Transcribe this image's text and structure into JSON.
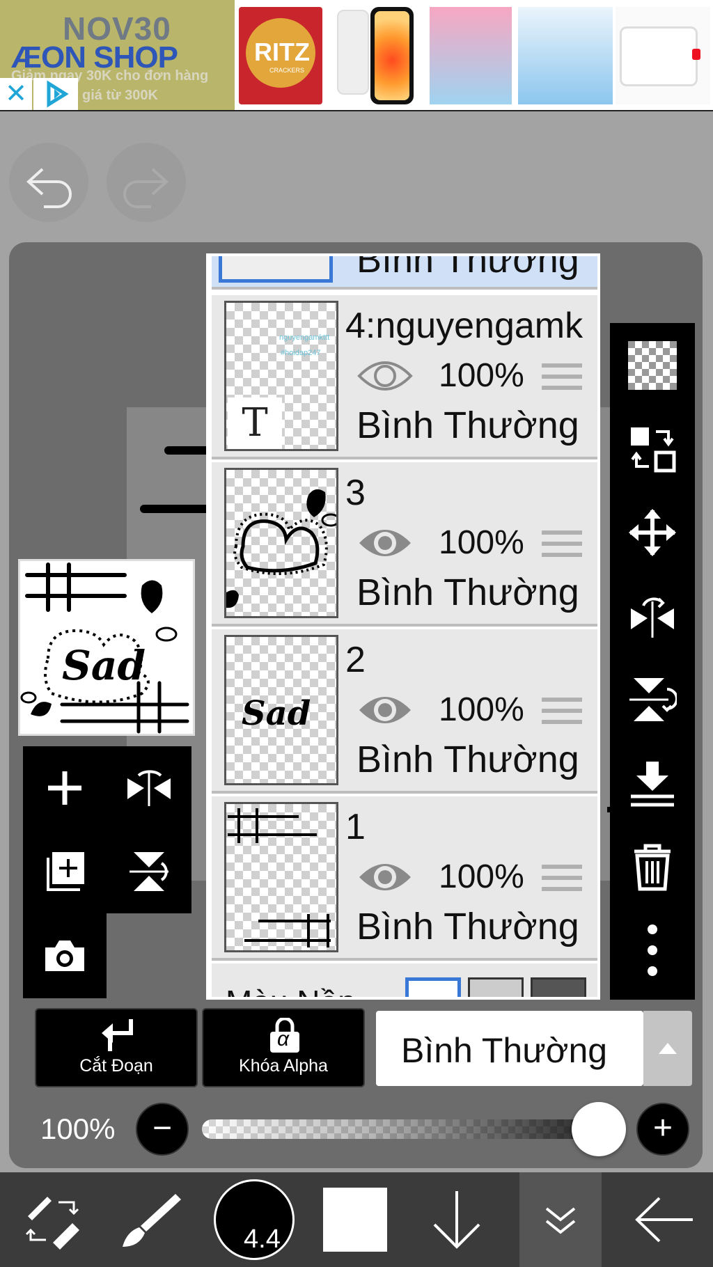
{
  "ad": {
    "promo_code": "NOV30",
    "brand_left": "ÆON",
    "brand_right": "SHOP",
    "line1": "Giảm ngay 30K cho đơn hàng",
    "line2": "giá từ 300K",
    "close_glyph": "✕",
    "product_ritz_text": "RITZ",
    "product_ritz_sub": "CRACKERS"
  },
  "toolbar_top": {
    "undo_icon": "undo-icon",
    "redo_icon": "redo-icon"
  },
  "layers": {
    "top_partial_blend": "Bình Thường",
    "items": [
      {
        "name": "4:nguyengamk",
        "opacity": "100%",
        "blend": "Bình Thường",
        "visible": true,
        "thumb_text1": "nguyengamkttt",
        "thumb_text2": "#hoidap247",
        "type_glyph": "T"
      },
      {
        "name": "3",
        "opacity": "100%",
        "blend": "Bình Thường",
        "visible": true
      },
      {
        "name": "2",
        "opacity": "100%",
        "blend": "Bình Thường",
        "visible": true,
        "thumb_text1": "Sad"
      },
      {
        "name": "1",
        "opacity": "100%",
        "blend": "Bình Thường",
        "visible": true
      }
    ],
    "background_label": "Màu Nền"
  },
  "preview": {
    "text": "Sad"
  },
  "controls": {
    "clip_label": "Cắt Đoạn",
    "alpha_lock_label": "Khóa Alpha",
    "alpha_glyph": "α",
    "blend_mode": "Bình Thường",
    "opacity_label": "100%",
    "opacity_value": 1.0,
    "minus_glyph": "−",
    "plus_glyph": "+"
  },
  "bottom_bar": {
    "brush_size": "4.4",
    "color": "#000000",
    "secondary_color": "#ffffff"
  },
  "colors": {
    "accent_blue": "#3a78d8",
    "panel_black": "#000000",
    "work_gray": "#6c6c6c"
  }
}
